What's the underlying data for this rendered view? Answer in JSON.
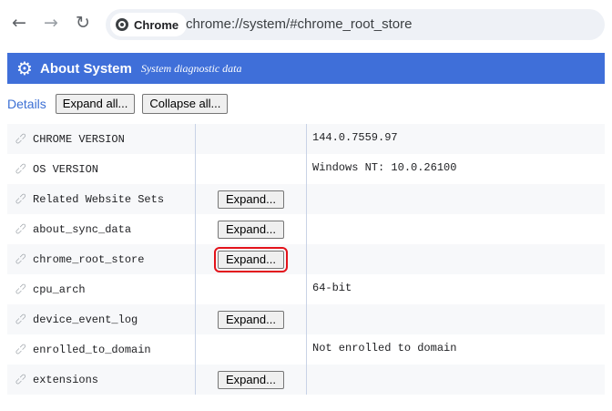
{
  "browser": {
    "chip_label": "Chrome",
    "url": "chrome://system/#chrome_root_store",
    "icons": {
      "back": "back-arrow-icon",
      "forward": "forward-arrow-icon",
      "reload": "reload-icon",
      "chip": "chrome-logo-icon"
    }
  },
  "header": {
    "title": "About System",
    "subtitle": "System diagnostic data",
    "icon": "gear-icon",
    "color": "#3f6fd9"
  },
  "details": {
    "label": "Details",
    "expand_all": "Expand all...",
    "collapse_all": "Collapse all..."
  },
  "rows": [
    {
      "name": "CHROME VERSION",
      "button": "",
      "value": "144.0.7559.97"
    },
    {
      "name": "OS VERSION",
      "button": "",
      "value": "Windows NT: 10.0.26100"
    },
    {
      "name": "Related Website Sets",
      "button": "Expand...",
      "value": ""
    },
    {
      "name": "about_sync_data",
      "button": "Expand...",
      "value": ""
    },
    {
      "name": "chrome_root_store",
      "button": "Expand...",
      "value": "",
      "highlighted": true
    },
    {
      "name": "cpu_arch",
      "button": "",
      "value": "64-bit"
    },
    {
      "name": "device_event_log",
      "button": "Expand...",
      "value": ""
    },
    {
      "name": "enrolled_to_domain",
      "button": "",
      "value": "Not enrolled to domain"
    },
    {
      "name": "extensions",
      "button": "Expand...",
      "value": ""
    }
  ],
  "highlight_color": "#e3131b"
}
